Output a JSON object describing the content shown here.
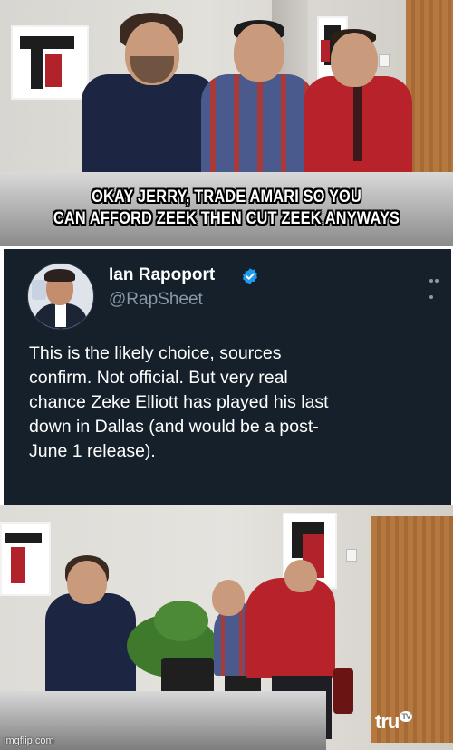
{
  "top_panel": {
    "caption_line1": "OKAY JERRY, TRADE AMARI SO YOU",
    "caption_line2": "CAN AFFORD ZEEK THEN CUT ZEEK ANYWAYS"
  },
  "tweet": {
    "display_name": "Ian Rapoport",
    "handle": "@RapSheet",
    "verified": true,
    "icons": [
      "avatar",
      "verified-badge-icon",
      "more-options-icon"
    ],
    "lines": [
      "This is the likely choice, sources",
      "confirm. Not official. But very real",
      "chance Zeke Elliott has played his last",
      "down in Dallas (and would be a post-",
      "June 1 release)."
    ],
    "colors": {
      "background": "#15202b",
      "text": "#ffffff",
      "muted": "#8b98a5",
      "verified": "#1d9bf0"
    }
  },
  "bottom_panel": {
    "channel_logo": "tru",
    "channel_logo_badge": "TV",
    "watermark": "imgflip.com"
  }
}
